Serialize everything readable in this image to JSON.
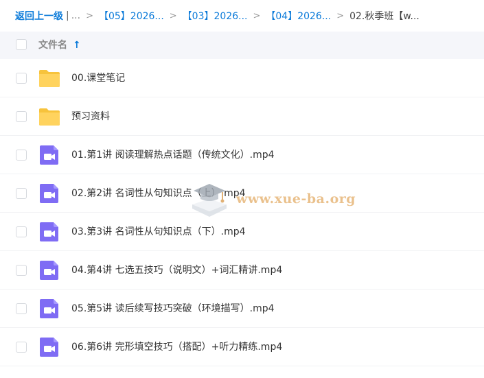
{
  "breadcrumb": {
    "back": "返回上一级",
    "sep_bar": "|",
    "ellipsis": "...",
    "chevron": ">",
    "crumbs": [
      "【05】2026...",
      "【03】2026...",
      "【04】2026..."
    ],
    "current": "02.秋季班【w..."
  },
  "header": {
    "column_name": "文件名",
    "sort_arrow": "↑"
  },
  "files": [
    {
      "type": "folder",
      "name": "00.课堂笔记"
    },
    {
      "type": "folder",
      "name": "预习资料"
    },
    {
      "type": "video",
      "name": "01.第1讲 阅读理解热点话题（传统文化）.mp4"
    },
    {
      "type": "video",
      "name": "02.第2讲 名词性从句知识点（上）.mp4"
    },
    {
      "type": "video",
      "name": "03.第3讲 名词性从句知识点（下）.mp4"
    },
    {
      "type": "video",
      "name": "04.第4讲 七选五技巧（说明文）+词汇精讲.mp4"
    },
    {
      "type": "video",
      "name": "05.第5讲 读后续写技巧突破（环境描写）.mp4"
    },
    {
      "type": "video",
      "name": "06.第6讲 完形填空技巧（搭配）+听力精练.mp4"
    }
  ],
  "watermark": {
    "text": "www.xue-ba.org"
  },
  "colors": {
    "link": "#0a7ad9",
    "folder": "#ffd35e",
    "video": "#7f6cf4",
    "header_bg": "#f5f6fa"
  }
}
